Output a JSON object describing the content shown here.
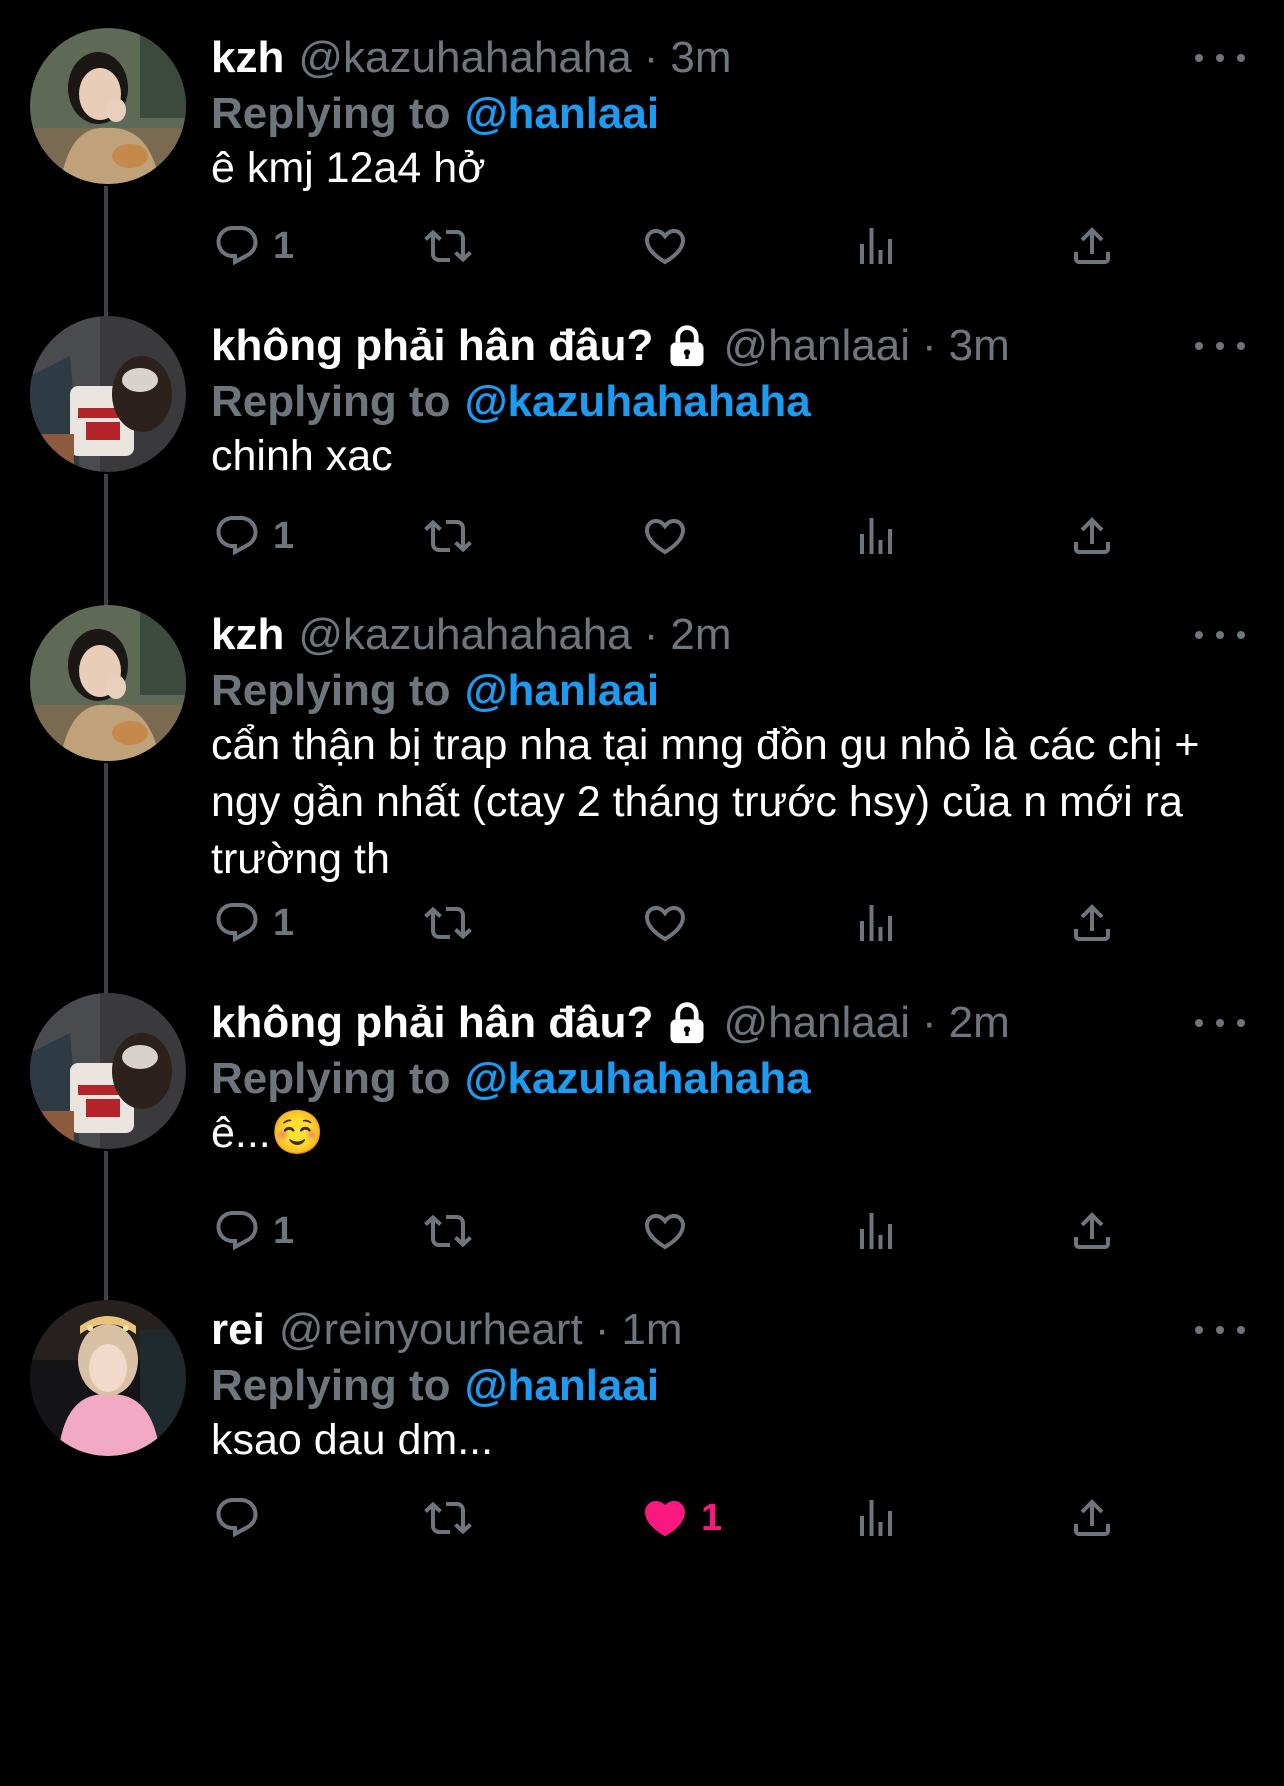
{
  "replying_label": "Replying to",
  "tweets": [
    {
      "name": "kzh",
      "handle": "@kazuhahahaha",
      "time": "3m",
      "replying_to": "@hanlaai",
      "text": "ê kmj 12a4 hở",
      "reply_count": "1",
      "like_count": "",
      "liked": false,
      "locked": false,
      "avatar": "photo-girl-beige-coat"
    },
    {
      "name": "không phải hân đâu?",
      "handle": "@hanlaai",
      "time": "3m",
      "replying_to": "@kazuhahahaha",
      "text": "chinh xac",
      "reply_count": "1",
      "like_count": "",
      "liked": false,
      "locked": true,
      "avatar": "photo-girl-bulls-jersey"
    },
    {
      "name": "kzh",
      "handle": "@kazuhahahaha",
      "time": "2m",
      "replying_to": "@hanlaai",
      "text": "cẩn thận bị trap nha tại mng đồn gu nhỏ là các chị + ngy gần nhất (ctay 2 tháng trước hsy) của n mới ra trường th",
      "reply_count": "1",
      "like_count": "",
      "liked": false,
      "locked": false,
      "avatar": "photo-girl-beige-coat"
    },
    {
      "name": "không phải hân đâu?",
      "handle": "@hanlaai",
      "time": "2m",
      "replying_to": "@kazuhahahaha",
      "text": "ê...☺️",
      "reply_count": "1",
      "like_count": "",
      "liked": false,
      "locked": true,
      "avatar": "photo-girl-bulls-jersey"
    },
    {
      "name": "rei",
      "handle": "@reinyourheart",
      "time": "1m",
      "replying_to": "@hanlaai",
      "text": "ksao dau dm...",
      "reply_count": "",
      "like_count": "1",
      "liked": true,
      "locked": false,
      "avatar": "photo-girl-pink-shirt"
    }
  ],
  "colors": {
    "background": "#000000",
    "secondary_text": "#6e767d",
    "mention": "#1d9bf0",
    "like": "#f91880",
    "thread_line": "#3d4248"
  },
  "icons": [
    "reply-icon",
    "retweet-icon",
    "like-icon",
    "views-icon",
    "share-icon",
    "more-icon",
    "lock-icon"
  ]
}
